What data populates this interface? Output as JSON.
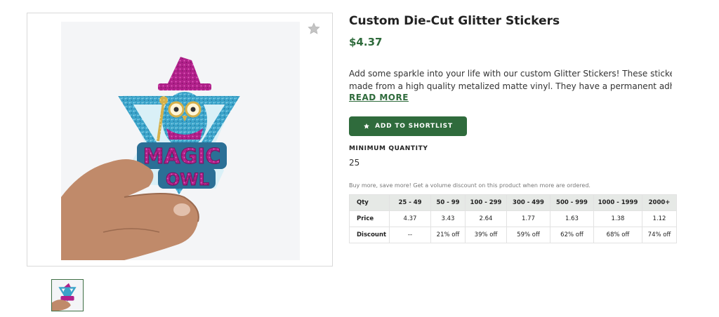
{
  "product": {
    "title": "Custom Die-Cut Glitter Stickers",
    "price": "$4.37",
    "description_line1": "Add some sparkle into your life with our custom Glitter Stickers! These stickers are",
    "description_line2": "made from a high quality metalized matte vinyl. They have a permanent adhesive a…",
    "read_more": "READ MORE",
    "shortlist_label": "ADD TO SHORTLIST",
    "min_qty_label": "MINIMUM QUANTITY",
    "min_qty_value": "25",
    "volume_note": "Buy more, save more! Get a volume discount on this product when more are ordered."
  },
  "image": {
    "sticker_text_line1": "MAGIC",
    "sticker_text_line2": "OWL"
  },
  "pricing_table": {
    "headers": [
      "Qty",
      "25 - 49",
      "50 - 99",
      "100 - 299",
      "300 - 499",
      "500 - 999",
      "1000 - 1999",
      "2000+"
    ],
    "price_row": [
      "Price",
      "4.37",
      "3.43",
      "2.64",
      "1.77",
      "1.63",
      "1.38",
      "1.12"
    ],
    "discount_row": [
      "Discount",
      "--",
      "21% off",
      "39% off",
      "59% off",
      "62% off",
      "68% off",
      "74% off"
    ]
  },
  "colors": {
    "brand_green": "#2f6b3c",
    "table_header_bg": "#e6e9e6",
    "star_gray": "#c4c4c4"
  },
  "icons": {
    "favorite": "star-icon",
    "shortlist": "star-icon"
  }
}
